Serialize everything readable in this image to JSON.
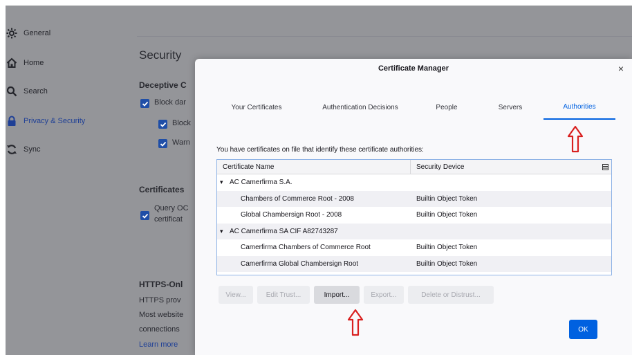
{
  "sidebar": {
    "items": [
      {
        "label": "General",
        "icon": "gear-icon"
      },
      {
        "label": "Home",
        "icon": "home-icon"
      },
      {
        "label": "Search",
        "icon": "search-icon"
      },
      {
        "label": "Privacy & Security",
        "icon": "lock-icon",
        "active": true
      },
      {
        "label": "Sync",
        "icon": "sync-icon"
      }
    ]
  },
  "settings": {
    "security_heading": "Security",
    "deceptive_heading": "Deceptive C",
    "block_dangerous": "Block dar",
    "block_sub": "Block",
    "warn_sub": "Warn",
    "certificates_heading": "Certificates",
    "query_ocsp_line1": "Query OC",
    "query_ocsp_line2": "certificat",
    "https_heading": "HTTPS-Onl",
    "https_line1": "HTTPS prov",
    "https_line2": "Most website",
    "https_line3": "connections",
    "learn_more": "Learn more"
  },
  "dialog": {
    "title": "Certificate Manager",
    "close_glyph": "×",
    "tabs": [
      {
        "label": "Your Certificates",
        "selected": false
      },
      {
        "label": "Authentication Decisions",
        "selected": false
      },
      {
        "label": "People",
        "selected": false
      },
      {
        "label": "Servers",
        "selected": false
      },
      {
        "label": "Authorities",
        "selected": true
      }
    ],
    "intro": "You have certificates on file that identify these certificate authorities:",
    "columns": {
      "name": "Certificate Name",
      "device": "Security Device"
    },
    "rows": [
      {
        "type": "group",
        "name": "AC Camerfirma S.A.",
        "device": ""
      },
      {
        "type": "cert",
        "name": "Chambers of Commerce Root - 2008",
        "device": "Builtin Object Token"
      },
      {
        "type": "cert",
        "name": "Global Chambersign Root - 2008",
        "device": "Builtin Object Token"
      },
      {
        "type": "group",
        "name": "AC Camerfirma SA CIF A82743287",
        "device": ""
      },
      {
        "type": "cert",
        "name": "Camerfirma Chambers of Commerce Root",
        "device": "Builtin Object Token"
      },
      {
        "type": "cert",
        "name": "Camerfirma Global Chambersign Root",
        "device": "Builtin Object Token"
      }
    ],
    "buttons": {
      "view": "View...",
      "edit_trust": "Edit Trust...",
      "import": "Import...",
      "export": "Export...",
      "delete": "Delete or Distrust..."
    },
    "ok": "OK"
  },
  "colors": {
    "accent": "#0061e0",
    "annotation_arrow": "#d9201f",
    "overlay_gray": "#949599"
  }
}
